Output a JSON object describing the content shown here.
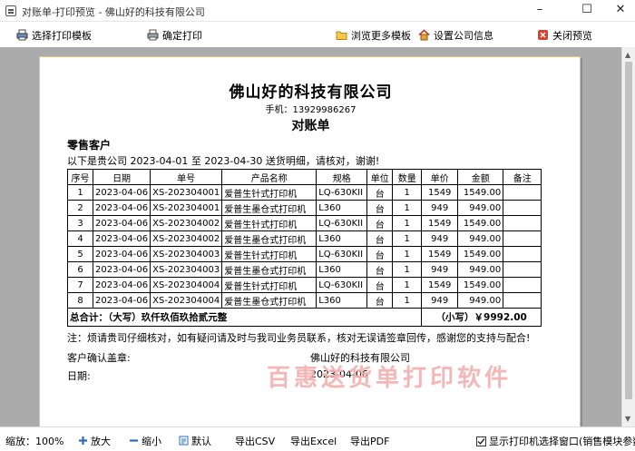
{
  "window": {
    "title": "对账单-打印预览 - 佛山好的科技有限公司"
  },
  "toolbar": {
    "select_template": "选择打印模板",
    "confirm_print": "确定打印",
    "browse_templates": "浏览更多模板",
    "company_info": "设置公司信息",
    "close_preview": "关闭预览"
  },
  "document": {
    "company": "佛山好的科技有限公司",
    "phone": "手机：13929986267",
    "title": "对账单",
    "customer": "零售客户",
    "intro": "以下是贵公司 2023-04-01 至 2023-04-30 送货明细，请核对，谢谢!",
    "columns": [
      "序号",
      "日期",
      "单号",
      "产品名称",
      "规格",
      "单位",
      "数量",
      "单价",
      "金额",
      "备注"
    ],
    "rows": [
      {
        "no": "1",
        "date": "2023-04-06",
        "order": "XS-202304001",
        "product": "爱普生针式打印机",
        "spec": "LQ-630KII",
        "unit": "台",
        "qty": "1",
        "price": "1549",
        "amount": "1549.00",
        "remark": ""
      },
      {
        "no": "2",
        "date": "2023-04-06",
        "order": "XS-202304001",
        "product": "爱普生墨仓式打印机",
        "spec": "L360",
        "unit": "台",
        "qty": "1",
        "price": "949",
        "amount": "949.00",
        "remark": ""
      },
      {
        "no": "3",
        "date": "2023-04-06",
        "order": "XS-202304002",
        "product": "爱普生针式打印机",
        "spec": "LQ-630KII",
        "unit": "台",
        "qty": "1",
        "price": "1549",
        "amount": "1549.00",
        "remark": ""
      },
      {
        "no": "4",
        "date": "2023-04-06",
        "order": "XS-202304002",
        "product": "爱普生墨仓式打印机",
        "spec": "L360",
        "unit": "台",
        "qty": "1",
        "price": "949",
        "amount": "949.00",
        "remark": ""
      },
      {
        "no": "5",
        "date": "2023-04-06",
        "order": "XS-202304003",
        "product": "爱普生针式打印机",
        "spec": "LQ-630KII",
        "unit": "台",
        "qty": "1",
        "price": "1549",
        "amount": "1549.00",
        "remark": ""
      },
      {
        "no": "6",
        "date": "2023-04-06",
        "order": "XS-202304003",
        "product": "爱普生墨仓式打印机",
        "spec": "L360",
        "unit": "台",
        "qty": "1",
        "price": "949",
        "amount": "949.00",
        "remark": ""
      },
      {
        "no": "7",
        "date": "2023-04-06",
        "order": "XS-202304004",
        "product": "爱普生针式打印机",
        "spec": "LQ-630KII",
        "unit": "台",
        "qty": "1",
        "price": "1549",
        "amount": "1549.00",
        "remark": ""
      },
      {
        "no": "8",
        "date": "2023-04-06",
        "order": "XS-202304004",
        "product": "爱普生墨仓式打印机",
        "spec": "L360",
        "unit": "台",
        "qty": "1",
        "price": "949",
        "amount": "949.00",
        "remark": ""
      }
    ],
    "total_label": "总合计：（大写）玖仟玖佰玖拾贰元整",
    "total_small": "（小写）￥9992.00",
    "note": "注：烦请贵司仔细核对，如有疑问请及时与我司业务员联系，核对无误请签章回传，感谢您的支持与配合!",
    "customer_sign": "客户确认盖章:",
    "supplier": "佛山好的科技有限公司",
    "date_label": "日期:",
    "date_value": "2023-04-06",
    "watermark": "百惠送货单打印软件"
  },
  "statusbar": {
    "zoom": "缩放：100%",
    "zoom_in": "放大",
    "zoom_out": "缩小",
    "default": "默认",
    "export_csv": "导出CSV",
    "export_excel": "导出Excel",
    "export_pdf": "导出PDF",
    "show_printer": "显示打印机选择窗口(销售模块参数"
  },
  "colors": {
    "paper_border": "#e2c96b",
    "preview_bg": "#ababab",
    "watermark": "#f3b0b0"
  },
  "icons": {
    "select_template": "printer-template-icon",
    "confirm_print": "printer-icon",
    "browse_templates": "folder-icon",
    "company_info": "house-icon",
    "close_preview": "close-icon"
  }
}
